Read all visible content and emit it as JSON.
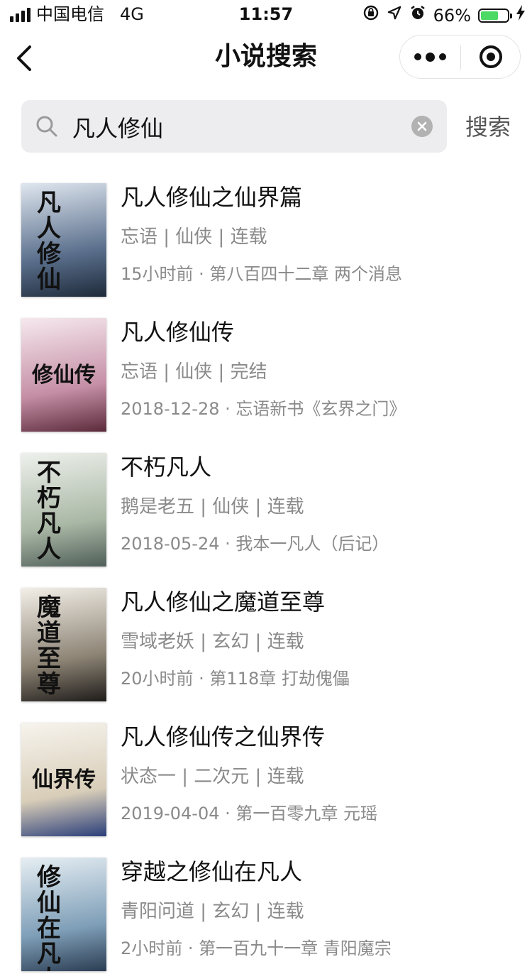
{
  "status_bar": {
    "carrier": "中国电信",
    "network": "4G",
    "time": "11:57",
    "battery": "66%",
    "battery_level": 0.66,
    "icons": [
      "lock-rotation-icon",
      "location-arrow-icon",
      "alarm-icon",
      "charging-bolt-icon"
    ]
  },
  "nav": {
    "title": "小说搜索"
  },
  "search": {
    "query": "凡人修仙",
    "button_label": "搜索"
  },
  "results": [
    {
      "title": "凡人修仙之仙界篇",
      "meta": "忘语 | 仙侠 | 连载",
      "update": "15小时前 · 第八百四十二章 两个消息",
      "cover_text": "凡人修仙",
      "cover_colors": [
        "#dfe6ef",
        "#5a6f8c",
        "#1e2a3a"
      ]
    },
    {
      "title": "凡人修仙传",
      "meta": "忘语 | 仙侠 | 完结",
      "update": "2018-12-28 · 忘语新书《玄界之门》",
      "cover_text": "修仙传",
      "cover_colors": [
        "#f6e9ee",
        "#c58fa6",
        "#5a2a3a"
      ]
    },
    {
      "title": "不朽凡人",
      "meta": "鹅是老五 | 仙侠 | 连载",
      "update": "2018-05-24 · 我本一凡人（后记）",
      "cover_text": "不朽凡人",
      "cover_colors": [
        "#eef1ec",
        "#a9b7a5",
        "#4f5e58"
      ]
    },
    {
      "title": "凡人修仙之魔道至尊",
      "meta": "雪域老妖 | 玄幻 | 连载",
      "update": "20小时前 · 第118章 打劫傀儡",
      "cover_text": "魔道至尊",
      "cover_colors": [
        "#f3efe8",
        "#8d8475",
        "#1f1c1a"
      ]
    },
    {
      "title": "凡人修仙传之仙界传",
      "meta": "状态一 | 二次元 | 连载",
      "update": "2019-04-04 · 第一百零九章 元瑶",
      "cover_text": "仙界传",
      "cover_colors": [
        "#f7f4ee",
        "#d8cdb8",
        "#2a3e7a"
      ]
    },
    {
      "title": "穿越之修仙在凡人",
      "meta": "青阳问道 | 玄幻 | 连载",
      "update": "2小时前 · 第一百九十一章 青阳魔宗",
      "cover_text": "修仙在凡人",
      "cover_colors": [
        "#e6eef3",
        "#7f9fb8",
        "#2b3d52"
      ]
    }
  ]
}
